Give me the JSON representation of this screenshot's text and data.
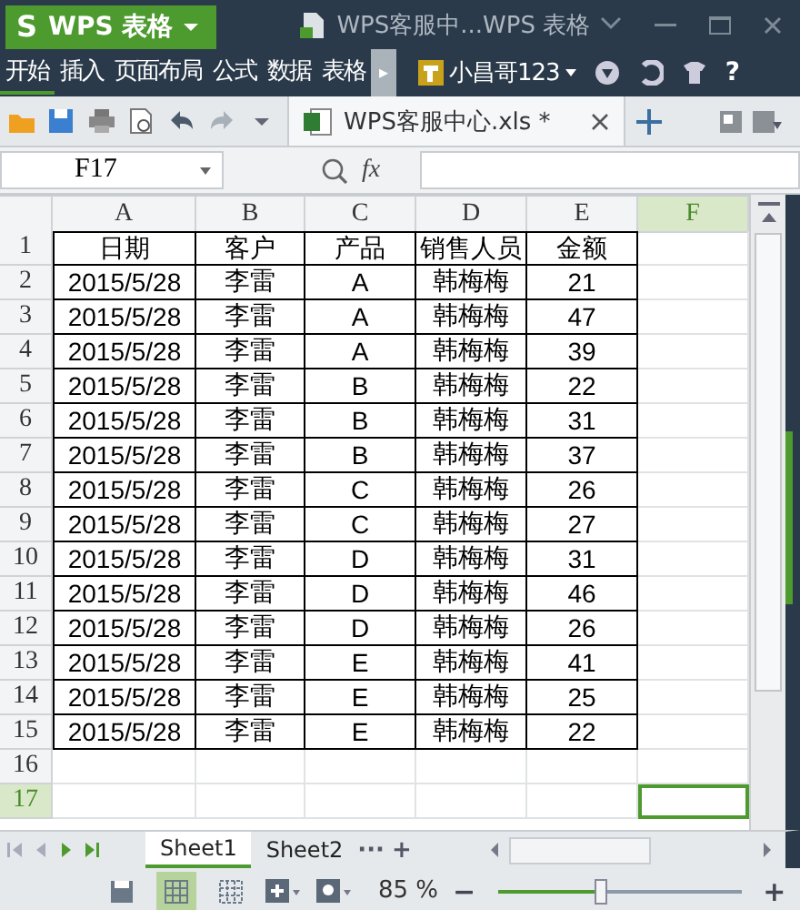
{
  "app_button": {
    "logo": "S",
    "label": "WPS 表格"
  },
  "window": {
    "title": "WPS客服中...WPS 表格"
  },
  "menu": {
    "items": [
      {
        "label": "开始",
        "selected": true
      },
      {
        "label": "插入",
        "selected": false
      },
      {
        "label": "页面布局",
        "selected": false
      },
      {
        "label": "公式",
        "selected": false
      },
      {
        "label": "数据",
        "selected": false
      },
      {
        "label": "表格",
        "selected": false
      }
    ],
    "more": "▸",
    "user": "小昌哥123",
    "help": "?"
  },
  "document_tabs": [
    {
      "label": "WPS客服中心.xls *",
      "selected": true
    }
  ],
  "formula_bar": {
    "name_box": "F17",
    "fx": "fx"
  },
  "sheet": {
    "columns": [
      {
        "label": "A",
        "selected": false
      },
      {
        "label": "B",
        "selected": false
      },
      {
        "label": "C",
        "selected": false
      },
      {
        "label": "D",
        "selected": false
      },
      {
        "label": "E",
        "selected": false
      },
      {
        "label": "F",
        "selected": true
      }
    ],
    "rows": [
      {
        "number": "1",
        "selected": false,
        "cells": [
          "日期",
          "客户",
          "产品",
          "销售人员",
          "金额"
        ]
      },
      {
        "number": "2",
        "selected": false,
        "cells": [
          "2015/5/28",
          "李雷",
          "A",
          "韩梅梅",
          "21"
        ]
      },
      {
        "number": "3",
        "selected": false,
        "cells": [
          "2015/5/28",
          "李雷",
          "A",
          "韩梅梅",
          "47"
        ]
      },
      {
        "number": "4",
        "selected": false,
        "cells": [
          "2015/5/28",
          "李雷",
          "A",
          "韩梅梅",
          "39"
        ]
      },
      {
        "number": "5",
        "selected": false,
        "cells": [
          "2015/5/28",
          "李雷",
          "B",
          "韩梅梅",
          "22"
        ]
      },
      {
        "number": "6",
        "selected": false,
        "cells": [
          "2015/5/28",
          "李雷",
          "B",
          "韩梅梅",
          "31"
        ]
      },
      {
        "number": "7",
        "selected": false,
        "cells": [
          "2015/5/28",
          "李雷",
          "B",
          "韩梅梅",
          "37"
        ]
      },
      {
        "number": "8",
        "selected": false,
        "cells": [
          "2015/5/28",
          "李雷",
          "C",
          "韩梅梅",
          "26"
        ]
      },
      {
        "number": "9",
        "selected": false,
        "cells": [
          "2015/5/28",
          "李雷",
          "C",
          "韩梅梅",
          "27"
        ]
      },
      {
        "number": "10",
        "selected": false,
        "cells": [
          "2015/5/28",
          "李雷",
          "D",
          "韩梅梅",
          "31"
        ]
      },
      {
        "number": "11",
        "selected": false,
        "cells": [
          "2015/5/28",
          "李雷",
          "D",
          "韩梅梅",
          "46"
        ]
      },
      {
        "number": "12",
        "selected": false,
        "cells": [
          "2015/5/28",
          "李雷",
          "D",
          "韩梅梅",
          "26"
        ]
      },
      {
        "number": "13",
        "selected": false,
        "cells": [
          "2015/5/28",
          "李雷",
          "E",
          "韩梅梅",
          "41"
        ]
      },
      {
        "number": "14",
        "selected": false,
        "cells": [
          "2015/5/28",
          "李雷",
          "E",
          "韩梅梅",
          "25"
        ]
      },
      {
        "number": "15",
        "selected": false,
        "cells": [
          "2015/5/28",
          "李雷",
          "E",
          "韩梅梅",
          "22"
        ]
      },
      {
        "number": "16",
        "selected": false,
        "cells": []
      },
      {
        "number": "17",
        "selected": true,
        "cells": []
      }
    ]
  },
  "sheet_tabs": {
    "items": [
      {
        "label": "Sheet1",
        "selected": true
      },
      {
        "label": "Sheet2",
        "selected": false
      }
    ],
    "more": "···",
    "add": "+"
  },
  "status_bar": {
    "views": [
      {
        "kind": "save",
        "selected": false
      },
      {
        "kind": "normal",
        "selected": true
      },
      {
        "kind": "page",
        "selected": false
      }
    ],
    "zoom": "85 %",
    "zoom_slider": {
      "level": 0.42
    },
    "minus": "−",
    "plus": "+"
  }
}
